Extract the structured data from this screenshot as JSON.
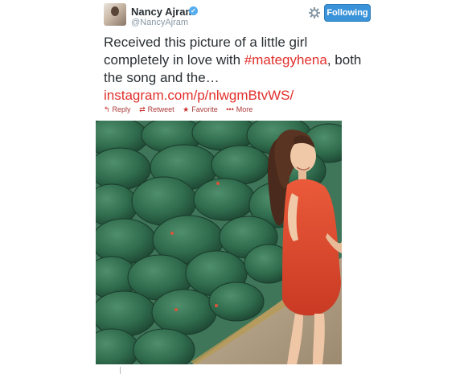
{
  "user": {
    "name": "Nancy Ajram",
    "handle": "@NancyAjram",
    "verified_mark": "✓"
  },
  "follow_button": {
    "label": "Following"
  },
  "tweet": {
    "line1": "Received this picture of a little girl",
    "line2_prefix": "completely in love with ",
    "hashtag": "#mategyhena",
    "line2_suffix": ", both",
    "line3": "the song and the…",
    "link": "instagram.com/p/nlwgmBtvWS/"
  },
  "actions": {
    "reply": "Reply",
    "retweet": "Retweet",
    "favorite": "Favorite",
    "more": "More"
  },
  "icons": {
    "settings": "gear-icon",
    "reply": "reply-icon",
    "retweet": "retweet-icon",
    "favorite": "star-icon",
    "more": "more-dots-icon"
  },
  "colors": {
    "link_red": "#e0302c",
    "follow_blue": "#3b94d9",
    "dress_red": "#e0492f",
    "watermelon_green": "#2f6b4c"
  }
}
